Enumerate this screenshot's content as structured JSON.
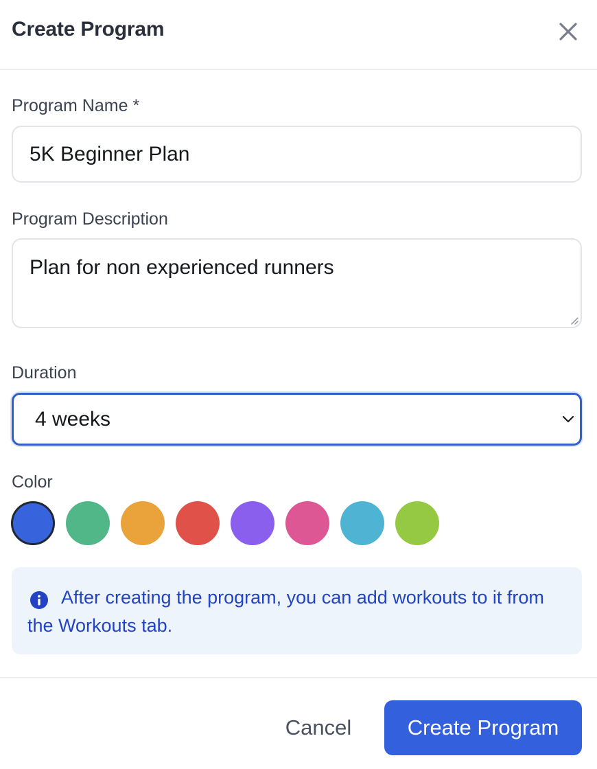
{
  "dialog": {
    "title": "Create Program",
    "close_icon": "close-icon"
  },
  "form": {
    "program_name": {
      "label": "Program Name *",
      "value": "5K Beginner Plan"
    },
    "program_description": {
      "label": "Program Description",
      "value": "Plan for non experienced runners"
    },
    "duration": {
      "label": "Duration",
      "selected": "4 weeks",
      "icon": "chevron-down-icon"
    },
    "color": {
      "label": "Color",
      "selected_index": 0,
      "options": [
        "#3763dd",
        "#52b788",
        "#eaa23a",
        "#df5149",
        "#8a5fee",
        "#de5795",
        "#4fb4d3",
        "#96c943"
      ]
    }
  },
  "info": {
    "icon": "info-icon",
    "text": "After creating the program, you can add workouts to it from the Workouts tab."
  },
  "footer": {
    "cancel_label": "Cancel",
    "submit_label": "Create Program"
  },
  "colors": {
    "primary": "#3361dd",
    "info_bg": "#edf4fc",
    "info_text": "#2243c4",
    "focus_border": "#2f5fc8"
  }
}
